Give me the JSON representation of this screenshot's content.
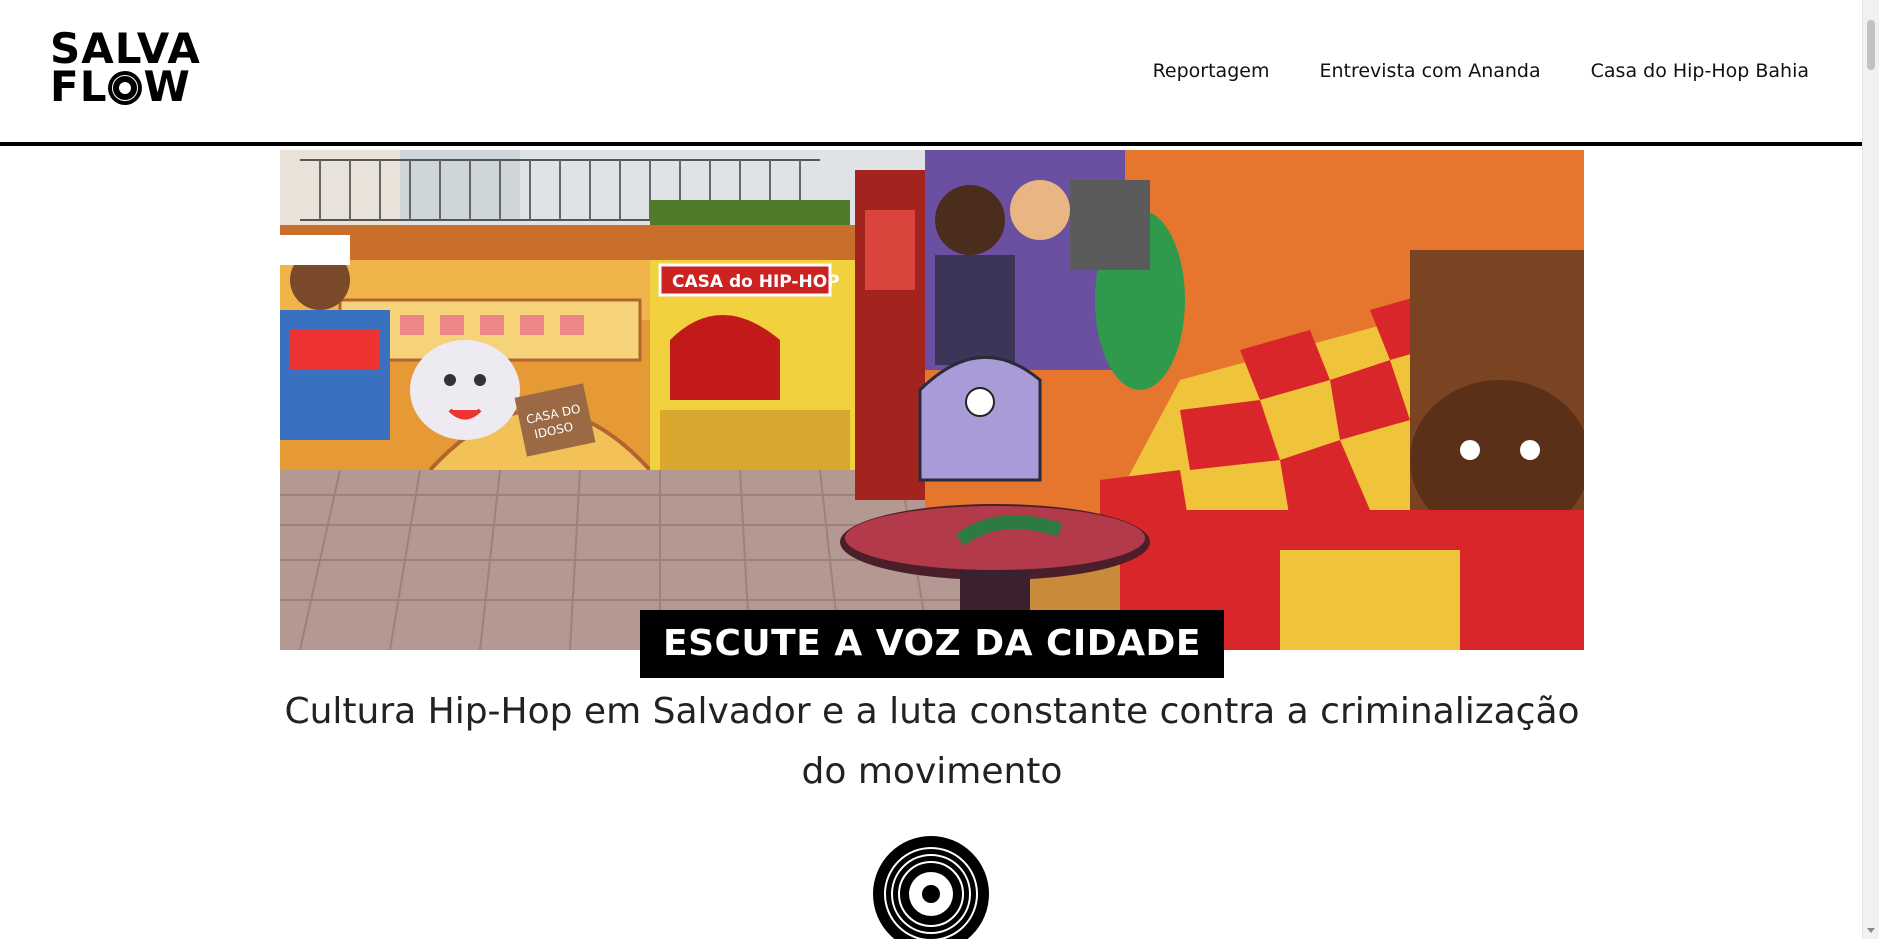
{
  "logo": {
    "line1": "SALVA",
    "line2_pre": "FL",
    "line2_post": "W",
    "icon": "vinyl-record-icon"
  },
  "nav": {
    "items": [
      {
        "label": "Reportagem"
      },
      {
        "label": "Entrevista com Ananda"
      },
      {
        "label": "Casa do Hip-Hop Bahia"
      }
    ]
  },
  "hero": {
    "image": "graffiti-mural-photo",
    "mural_text_sign": "CASA do HIP-HOP",
    "mural_text_board": "CASA DO IDOSO"
  },
  "banner": {
    "text": "ESCUTE A VOZ DA CIDADE"
  },
  "subtitle": {
    "line1": "Cultura Hip-Hop em Salvador e a luta constante contra a criminalização",
    "line2": "do movimento"
  },
  "vinyl_icon": "vinyl-record-icon",
  "colors": {
    "header_border": "#000000",
    "banner_bg": "#000000",
    "banner_text": "#ffffff",
    "text": "#222222"
  }
}
